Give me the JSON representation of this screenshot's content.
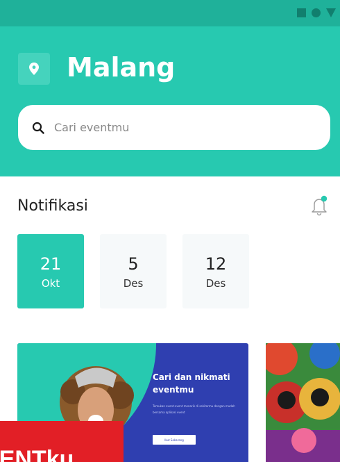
{
  "header": {
    "city": "Malang"
  },
  "search": {
    "placeholder": "Cari eventmu"
  },
  "notifications": {
    "title": "Notifikasi"
  },
  "dates": [
    {
      "day": "21",
      "month": "Okt",
      "active": true
    },
    {
      "day": "5",
      "month": "Des",
      "active": false
    },
    {
      "day": "12",
      "month": "Des",
      "active": false
    }
  ],
  "banner": {
    "title": "Cari dan nikmati eventmu",
    "body": "Temukan event-event menarik di sekitarmu dengan mudah bersama aplikasi event",
    "button": "Ikut Sekarang"
  },
  "promo": {
    "text": "VENTku"
  },
  "colors": {
    "primary": "#27c9b0",
    "status_bar": "#1fb19a",
    "banner_blue": "#2f3fb0",
    "promo_red": "#e21f26"
  }
}
